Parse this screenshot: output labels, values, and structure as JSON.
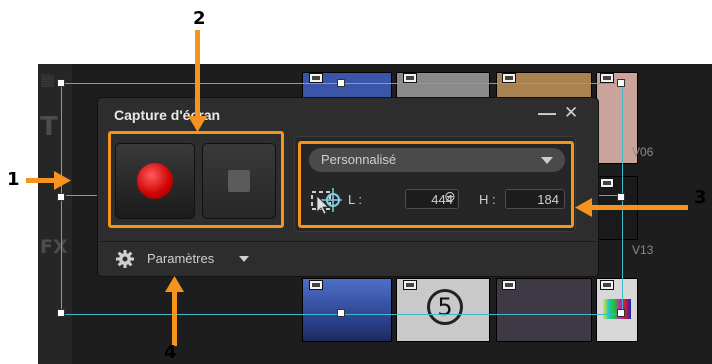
{
  "left_toolbar": {
    "title_tool_glyph": "T",
    "fx_tool_glyph": "FX"
  },
  "thumbnails": {
    "labels": [
      "V06",
      "V13"
    ],
    "countdown_digit": "5"
  },
  "panel": {
    "title": "Capture d'écran",
    "minimize_glyph": "—",
    "close_glyph": "✕",
    "preset_selected": "Personnalisé",
    "width_label": "L :",
    "width_value": "444",
    "link_glyph": "⊖",
    "height_label": "H :",
    "height_value": "184",
    "settings_label": "Paramètres"
  },
  "callouts": {
    "one": "1",
    "two": "2",
    "three": "3",
    "four": "4"
  },
  "colors": {
    "callout_orange": "#f5931f",
    "selection_cyan": "#3fb8c8",
    "record_red": "#cc0000"
  }
}
